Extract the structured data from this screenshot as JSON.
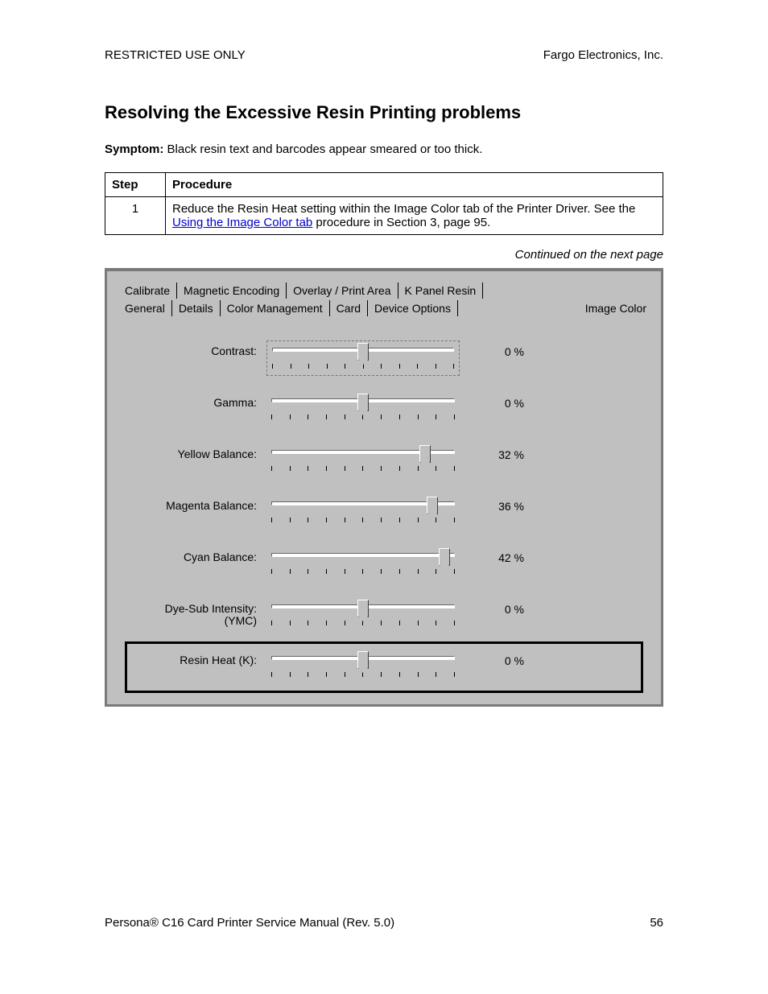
{
  "header": {
    "left": "RESTRICTED USE ONLY",
    "right": "Fargo Electronics, Inc."
  },
  "title": "Resolving the Excessive Resin Printing problems",
  "symptom_label": "Symptom:",
  "symptom_text": "Black resin text and barcodes appear smeared or too thick.",
  "table": {
    "head_step": "Step",
    "head_proc": "Procedure",
    "row1_step": "1",
    "row1_text_a": "Reduce the Resin Heat setting within the Image Color tab of the Printer Driver. See the ",
    "row1_link": "Using the Image Color tab",
    "row1_text_b": " procedure in Section 3, page 95."
  },
  "continued": "Continued on the next page",
  "tabs_top": {
    "t0": "Calibrate",
    "t1": "Magnetic Encoding",
    "t2": "Overlay / Print Area",
    "t3": "K Panel Resin"
  },
  "tabs_bottom": {
    "t0": "General",
    "t1": "Details",
    "t2": "Color Management",
    "t3": "Card",
    "t4": "Device Options",
    "t5": "Image Color"
  },
  "sliders": [
    {
      "label": "Contrast:",
      "value": "0 %",
      "pos": 50,
      "dotted": true
    },
    {
      "label": "Gamma:",
      "value": "0 %",
      "pos": 50,
      "dotted": false
    },
    {
      "label": "Yellow Balance:",
      "value": "32 %",
      "pos": 82,
      "dotted": false
    },
    {
      "label": "Magenta Balance:",
      "value": "36 %",
      "pos": 86,
      "dotted": false
    },
    {
      "label": "Cyan Balance:",
      "value": "42 %",
      "pos": 92,
      "dotted": false
    },
    {
      "label": "Dye-Sub Intensity:\n(YMC)",
      "value": "0 %",
      "pos": 50,
      "dotted": false
    },
    {
      "label": "Resin Heat  (K):",
      "value": "0 %",
      "pos": 50,
      "dotted": false,
      "highlight": true
    }
  ],
  "footer": {
    "left": "Persona® C16 Card Printer Service Manual (Rev. 5.0)",
    "right": "56"
  }
}
